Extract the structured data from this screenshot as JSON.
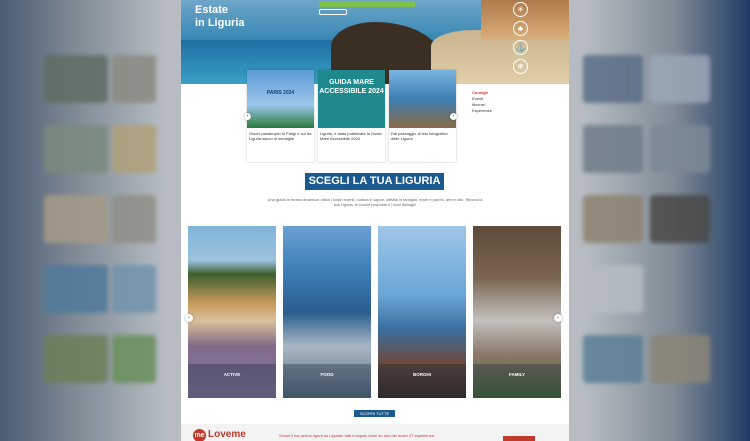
{
  "hero": {
    "title_line1": "Estate",
    "title_line2": "in Liguria",
    "button_label": "",
    "icons": [
      "sun-icon",
      "palm-icon",
      "ship-icon",
      "snowflake-icon"
    ]
  },
  "news": [
    {
      "caption": "Giochi paralimpici di Parigi e sul tra Liguria sacco di medaglie",
      "badge": "PARIS 2024"
    },
    {
      "caption": "Liguria, è stata pubblicata la Guida Mare Accessibile 2024",
      "badge": "GUIDA MARE ACCESSIBILE 2024"
    },
    {
      "caption": "Dal passaggio al lido fotografico delle Liguria",
      "badge": ""
    }
  ],
  "side_links": {
    "heading": "Consigli",
    "items": [
      "Eventi",
      "Itinerari",
      "Esperienze"
    ]
  },
  "section_title": "SCEGLI LA TUA LIGURIA",
  "intro": "Una guida in forma dinamica: visita i nostri eventi, cultura e sapori, attività in famiglia, mare e parchi, arte e sito. Ritrova la tua Liguria, le nostre proposte e i suoi dettagli!",
  "categories": [
    {
      "label": "ACTIVE"
    },
    {
      "label": "FOOD"
    },
    {
      "label": "BORGHI"
    },
    {
      "label": "FAMILY"
    }
  ],
  "more_label": "SCOPRI TUTTE",
  "footer": {
    "brand": "Loveme",
    "text": "Scopri il tuo animo ligure su Ligurian tutti e saprai come su uno dei nostri 27 esperienze."
  }
}
